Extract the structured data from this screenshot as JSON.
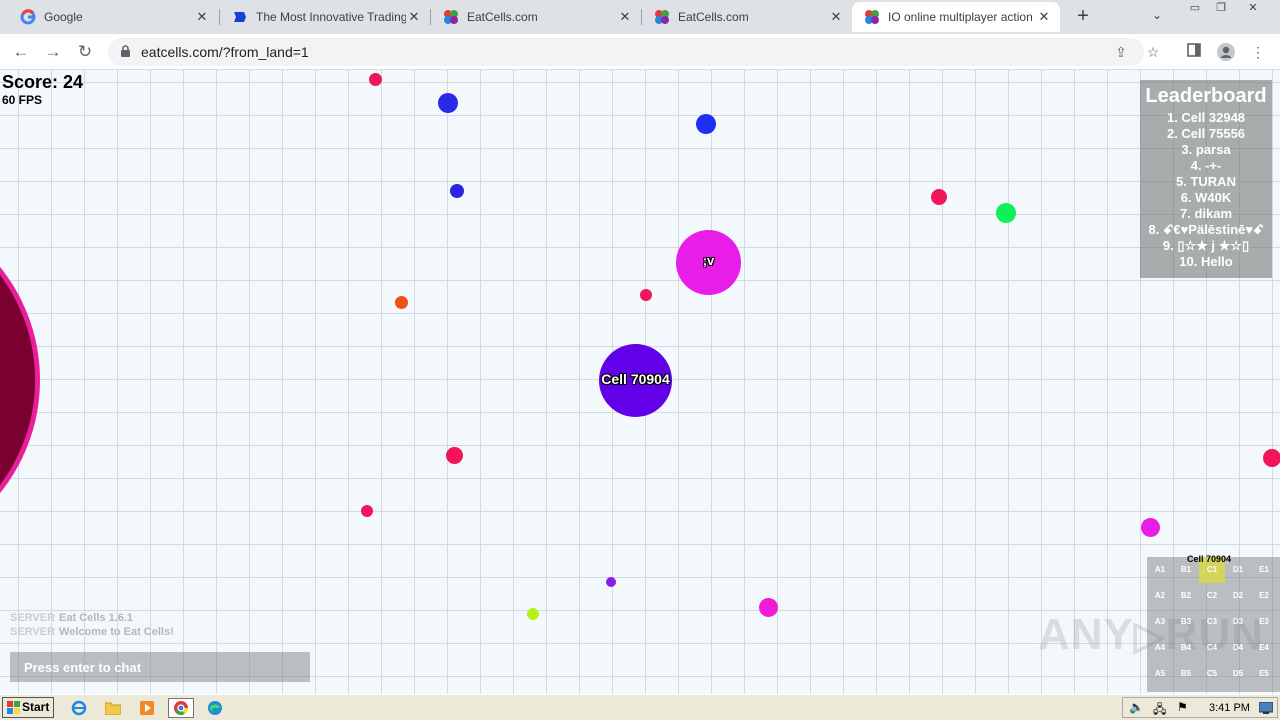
{
  "browser": {
    "tabs": [
      {
        "title": "Google",
        "favicon": "google-icon"
      },
      {
        "title": "The Most Innovative Trading Pl",
        "favicon": "trading-icon"
      },
      {
        "title": "EatCells.com",
        "favicon": "eatcells-icon"
      },
      {
        "title": "EatCells.com",
        "favicon": "eatcells-icon"
      },
      {
        "title": "IO online multiplayer action ga",
        "favicon": "eatcells-icon",
        "active": true
      }
    ],
    "url": "eatcells.com/?from_land=1"
  },
  "game": {
    "score_text": "Score: 24",
    "fps_text": "60 FPS",
    "player": {
      "name": "Cell 70904",
      "color": "#6200ea"
    },
    "other_cell": {
      "name": ";v",
      "color": "#e81ee8"
    },
    "leaderboard": {
      "title": "Leaderboard",
      "items": [
        "1. Cell 32948",
        "2. Cell 75556",
        "3. parsa",
        "4. -+-",
        "5. TURAN",
        "6. W40K",
        "7. dikam",
        "8. ꗃ€♥Pälēstinē♥ꗃ",
        "9. ▯☆★ j ★☆▯",
        "10. Hello"
      ]
    },
    "chat": {
      "messages": [
        {
          "sender": "SERVER",
          "text": "Eat Cells 1.6.1"
        },
        {
          "sender": "SERVER",
          "text": "Welcome to Eat Cells!"
        }
      ],
      "placeholder": "Press enter to chat"
    },
    "minimap": {
      "player_label": "Cell 70904",
      "grid": [
        [
          "A1",
          "B1",
          "C1",
          "D1",
          "E1"
        ],
        [
          "A2",
          "B2",
          "C2",
          "D2",
          "E2"
        ],
        [
          "A3",
          "B3",
          "C3",
          "D3",
          "E3"
        ],
        [
          "A4",
          "B4",
          "C4",
          "D4",
          "E4"
        ],
        [
          "A5",
          "B5",
          "C5",
          "D5",
          "E5"
        ]
      ],
      "active_sector": "C1"
    },
    "watermark": "ANY RUN"
  },
  "taskbar": {
    "start_label": "Start",
    "clock": "3:41 PM",
    "apps": [
      "ie-icon",
      "folder-icon",
      "media-player-icon",
      "chrome-icon",
      "edge-icon"
    ]
  }
}
